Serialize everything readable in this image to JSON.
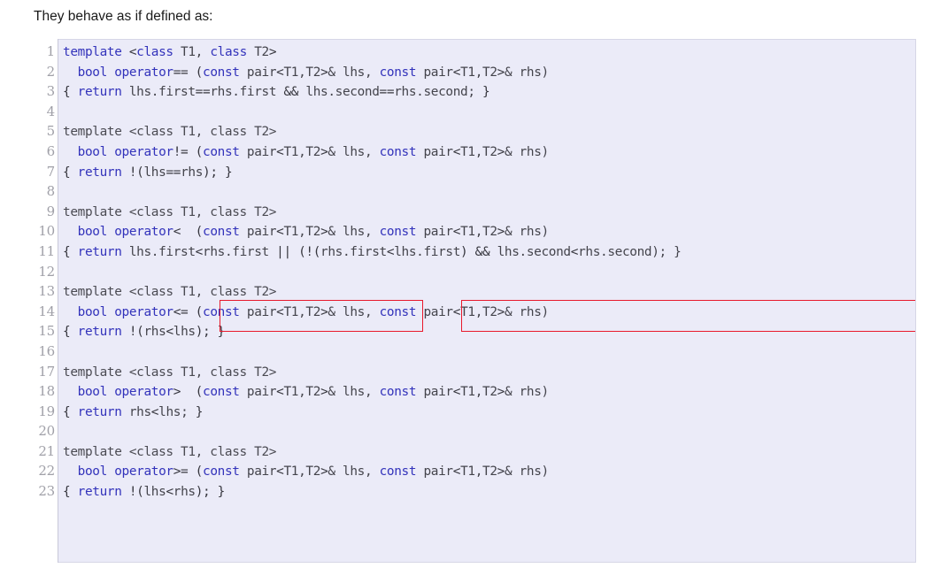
{
  "page": {
    "intro_text": "They behave as if defined as:",
    "background_color": "#ffffff",
    "code_background_color": "#ebebf8",
    "gutter_background_color": "#ffffff",
    "keyword_color": "#3333bb",
    "identifier_color": "#44444c",
    "line_number_color": "#a0a0a8",
    "annotation_color": "#e8192c"
  },
  "code": {
    "language": "C++",
    "line_numbers": [
      1,
      2,
      3,
      4,
      5,
      6,
      7,
      8,
      9,
      10,
      11,
      12,
      13,
      14,
      15,
      16,
      17,
      18,
      19,
      20,
      21,
      22,
      23
    ],
    "lines": [
      {
        "n": 1,
        "text": "template <class T1, class T2>"
      },
      {
        "n": 2,
        "text": "  bool operator== (const pair<T1,T2>& lhs, const pair<T1,T2>& rhs)"
      },
      {
        "n": 3,
        "text": "{ return lhs.first==rhs.first && lhs.second==rhs.second; }"
      },
      {
        "n": 4,
        "text": ""
      },
      {
        "n": 5,
        "text": "template <class T1, class T2>"
      },
      {
        "n": 6,
        "text": "  bool operator!= (const pair<T1,T2>& lhs, const pair<T1,T2>& rhs)"
      },
      {
        "n": 7,
        "text": "{ return !(lhs==rhs); }"
      },
      {
        "n": 8,
        "text": ""
      },
      {
        "n": 9,
        "text": "template <class T1, class T2>"
      },
      {
        "n": 10,
        "text": "  bool operator<  (const pair<T1,T2>& lhs, const pair<T1,T2>& rhs)"
      },
      {
        "n": 11,
        "text": "{ return lhs.first<rhs.first || (!(rhs.first<lhs.first) && lhs.second<rhs.second); }"
      },
      {
        "n": 12,
        "text": ""
      },
      {
        "n": 13,
        "text": "template <class T1, class T2>"
      },
      {
        "n": 14,
        "text": "  bool operator<= (const pair<T1,T2>& lhs, const pair<T1,T2>& rhs)"
      },
      {
        "n": 15,
        "text": "{ return !(rhs<lhs); }"
      },
      {
        "n": 16,
        "text": ""
      },
      {
        "n": 17,
        "text": "template <class T1, class T2>"
      },
      {
        "n": 18,
        "text": "  bool operator>  (const pair<T1,T2>& lhs, const pair<T1,T2>& rhs)"
      },
      {
        "n": 19,
        "text": "{ return rhs<lhs; }"
      },
      {
        "n": 20,
        "text": ""
      },
      {
        "n": 21,
        "text": "template <class T1, class T2>"
      },
      {
        "n": 22,
        "text": "  bool operator>= (const pair<T1,T2>& lhs, const pair<T1,T2>& rhs)"
      },
      {
        "n": 23,
        "text": "{ return !(lhs<rhs); }"
      }
    ],
    "tokens": {
      "line1": [
        [
          "kw",
          "template "
        ],
        [
          "op",
          "<"
        ],
        [
          "kw",
          "class"
        ],
        [
          "id",
          " T1, "
        ],
        [
          "kw",
          "class"
        ],
        [
          "id",
          " T2"
        ],
        [
          "op",
          ">"
        ]
      ],
      "line2": [
        [
          "id",
          "  "
        ],
        [
          "kw",
          "bool operator"
        ],
        [
          "op",
          "== ("
        ],
        [
          "kw",
          "const"
        ],
        [
          "id",
          " pair"
        ],
        [
          "op",
          "<"
        ],
        [
          "id",
          "T1,T2"
        ],
        [
          "op",
          ">"
        ],
        [
          "id",
          "& lhs, "
        ],
        [
          "kw",
          "const"
        ],
        [
          "id",
          " pair"
        ],
        [
          "op",
          "<"
        ],
        [
          "id",
          "T1,T2"
        ],
        [
          "op",
          ">"
        ],
        [
          "id",
          "& rhs)"
        ]
      ],
      "line3": [
        [
          "op",
          "{ "
        ],
        [
          "kw",
          "return"
        ],
        [
          "id",
          " lhs.first"
        ],
        [
          "op",
          "=="
        ],
        [
          "id",
          "rhs.first "
        ],
        [
          "op",
          "&&"
        ],
        [
          "id",
          " lhs.second"
        ],
        [
          "op",
          "=="
        ],
        [
          "id",
          "rhs.second; "
        ],
        [
          "op",
          "}"
        ]
      ],
      "line6": [
        [
          "id",
          "  "
        ],
        [
          "kw",
          "bool operator"
        ],
        [
          "op",
          "!= ("
        ],
        [
          "kw",
          "const"
        ],
        [
          "id",
          " pair"
        ],
        [
          "op",
          "<"
        ],
        [
          "id",
          "T1,T2"
        ],
        [
          "op",
          ">"
        ],
        [
          "id",
          "& lhs, "
        ],
        [
          "kw",
          "const"
        ],
        [
          "id",
          " pair"
        ],
        [
          "op",
          "<"
        ],
        [
          "id",
          "T1,T2"
        ],
        [
          "op",
          ">"
        ],
        [
          "id",
          "& rhs)"
        ]
      ],
      "line7": [
        [
          "op",
          "{ "
        ],
        [
          "kw",
          "return"
        ],
        [
          "op",
          " !("
        ],
        [
          "id",
          "lhs"
        ],
        [
          "op",
          "=="
        ],
        [
          "id",
          "rhs"
        ],
        [
          "op",
          "); }"
        ]
      ],
      "line10": [
        [
          "id",
          "  "
        ],
        [
          "kw",
          "bool operator"
        ],
        [
          "op",
          "<  ("
        ],
        [
          "kw",
          "const"
        ],
        [
          "id",
          " pair"
        ],
        [
          "op",
          "<"
        ],
        [
          "id",
          "T1,T2"
        ],
        [
          "op",
          ">"
        ],
        [
          "id",
          "& lhs, "
        ],
        [
          "kw",
          "const"
        ],
        [
          "id",
          " pair"
        ],
        [
          "op",
          "<"
        ],
        [
          "id",
          "T1,T2"
        ],
        [
          "op",
          ">"
        ],
        [
          "id",
          "& rhs)"
        ]
      ],
      "line11": [
        [
          "op",
          "{ "
        ],
        [
          "kw",
          "return"
        ],
        [
          "id",
          " lhs.first"
        ],
        [
          "op",
          "<"
        ],
        [
          "id",
          "rhs.first "
        ],
        [
          "op",
          "|| (!("
        ],
        [
          "id",
          "rhs.first"
        ],
        [
          "op",
          "<"
        ],
        [
          "id",
          "lhs.first"
        ],
        [
          "op",
          ") && "
        ],
        [
          "id",
          "lhs.second"
        ],
        [
          "op",
          "<"
        ],
        [
          "id",
          "rhs.second); }"
        ]
      ],
      "line14": [
        [
          "id",
          "  "
        ],
        [
          "kw",
          "bool operator"
        ],
        [
          "op",
          "<= ("
        ],
        [
          "kw",
          "const"
        ],
        [
          "id",
          " pair"
        ],
        [
          "op",
          "<"
        ],
        [
          "id",
          "T1,T2"
        ],
        [
          "op",
          ">"
        ],
        [
          "id",
          "& lhs, "
        ],
        [
          "kw",
          "const"
        ],
        [
          "id",
          " pair"
        ],
        [
          "op",
          "<"
        ],
        [
          "id",
          "T1,T2"
        ],
        [
          "op",
          ">"
        ],
        [
          "id",
          "& rhs)"
        ]
      ],
      "line15": [
        [
          "op",
          "{ "
        ],
        [
          "kw",
          "return"
        ],
        [
          "op",
          " !("
        ],
        [
          "id",
          "rhs"
        ],
        [
          "op",
          "<"
        ],
        [
          "id",
          "lhs"
        ],
        [
          "op",
          "); }"
        ]
      ],
      "line18": [
        [
          "id",
          "  "
        ],
        [
          "kw",
          "bool operator"
        ],
        [
          "op",
          ">  ("
        ],
        [
          "kw",
          "const"
        ],
        [
          "id",
          " pair"
        ],
        [
          "op",
          "<"
        ],
        [
          "id",
          "T1,T2"
        ],
        [
          "op",
          ">"
        ],
        [
          "id",
          "& lhs, "
        ],
        [
          "kw",
          "const"
        ],
        [
          "id",
          " pair"
        ],
        [
          "op",
          "<"
        ],
        [
          "id",
          "T1,T2"
        ],
        [
          "op",
          ">"
        ],
        [
          "id",
          "& rhs)"
        ]
      ],
      "line19": [
        [
          "op",
          "{ "
        ],
        [
          "kw",
          "return"
        ],
        [
          "id",
          " rhs"
        ],
        [
          "op",
          "<"
        ],
        [
          "id",
          "lhs; "
        ],
        [
          "op",
          "}"
        ]
      ],
      "line22": [
        [
          "id",
          "  "
        ],
        [
          "kw",
          "bool operator"
        ],
        [
          "op",
          ">= ("
        ],
        [
          "kw",
          "const"
        ],
        [
          "id",
          " pair"
        ],
        [
          "op",
          "<"
        ],
        [
          "id",
          "T1,T2"
        ],
        [
          "op",
          ">"
        ],
        [
          "id",
          "& lhs, "
        ],
        [
          "kw",
          "const"
        ],
        [
          "id",
          " pair"
        ],
        [
          "op",
          "<"
        ],
        [
          "id",
          "T1,T2"
        ],
        [
          "op",
          ">"
        ],
        [
          "id",
          "& rhs)"
        ]
      ],
      "line23": [
        [
          "op",
          "{ "
        ],
        [
          "kw",
          "return"
        ],
        [
          "op",
          " !("
        ],
        [
          "id",
          "lhs"
        ],
        [
          "op",
          "<"
        ],
        [
          "id",
          "rhs"
        ],
        [
          "op",
          "); }"
        ]
      ]
    }
  },
  "annotations": [
    {
      "id": "annot-box-left",
      "label": "lhs.first<rhs.first",
      "on_line": 11
    },
    {
      "id": "annot-box-right",
      "label": "(!(rhs.first<lhs.first) && lhs.second<rhs.second);",
      "on_line": 11
    }
  ]
}
